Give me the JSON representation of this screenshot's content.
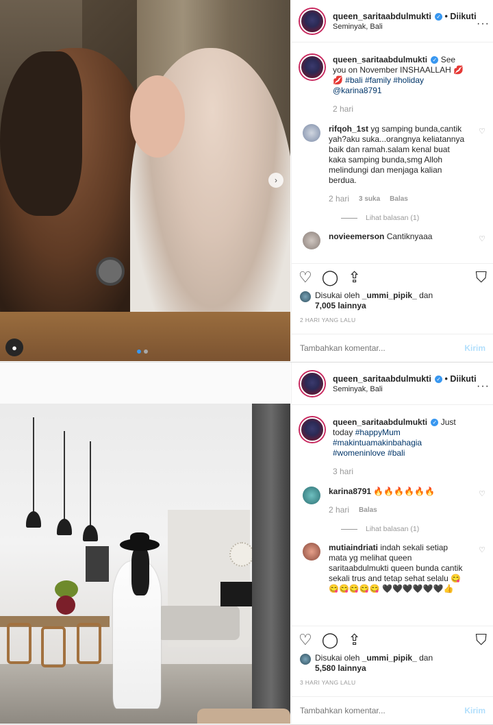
{
  "posts": [
    {
      "username": "queen_saritaabdulmukti",
      "follow": "Diikuti",
      "location": "Seminyak, Bali",
      "caption_user": "queen_saritaabdulmukti",
      "caption_text": "See you on November INSHAALLAH 💋💋",
      "caption_tags": "#bali #family #holiday @karina8791",
      "caption_time": "2 hari",
      "comments": [
        {
          "user": "rifqoh_1st",
          "text": "yg samping bunda,cantik yah?aku suka...orangnya keliatannya baik dan ramah.salam kenal buat kaka samping bunda,smg Alloh melindungi dan menjaga kalian berdua.",
          "time": "2 hari",
          "likes": "3 suka",
          "reply": "Balas"
        }
      ],
      "view_replies": "Lihat balasan (1)",
      "partial_comment_user": "novieemerson",
      "partial_comment_text": "Cantiknyaaa",
      "liked_by_prefix": "Disukai oleh",
      "liked_by_user": "_ummi_pipik_",
      "liked_by_and": "dan",
      "liked_by_others": "7,005 lainnya",
      "date": "2 HARI YANG LALU",
      "add_comment_placeholder": "Tambahkan komentar...",
      "post_button": "Kirim"
    },
    {
      "username": "queen_saritaabdulmukti",
      "follow": "Diikuti",
      "location": "Seminyak, Bali",
      "caption_user": "queen_saritaabdulmukti",
      "caption_text": "Just today",
      "caption_tags": "#happyMum #makintuamakinbahagia #womeninlove #bali",
      "caption_time": "3 hari",
      "comments": [
        {
          "user": "karina8791",
          "text": "🔥🔥🔥🔥🔥🔥",
          "time": "2 hari",
          "likes": "",
          "reply": "Balas"
        }
      ],
      "view_replies": "Lihat balasan (1)",
      "comment2_user": "mutiaindriati",
      "comment2_text": "indah sekali setiap mata yg melihat queen saritaabdulmukti queen bunda cantik sekali trus and tetap sehat selalu 😋😋😋😋😋😋 🖤🖤🖤🖤🖤🖤👍",
      "liked_by_prefix": "Disukai oleh",
      "liked_by_user": "_ummi_pipik_",
      "liked_by_and": "dan",
      "liked_by_others": "5,580 lainnya",
      "date": "3 HARI YANG LALU",
      "add_comment_placeholder": "Tambahkan komentar...",
      "post_button": "Kirim"
    }
  ],
  "icons": {
    "heart": "heart-icon",
    "comment": "comment-icon",
    "share": "share-icon",
    "save": "bookmark-icon",
    "more": "more-icon"
  },
  "colors": {
    "link": "#003569",
    "verified": "#3897f0",
    "muted": "#999999",
    "story_ring": "#c8285e"
  }
}
